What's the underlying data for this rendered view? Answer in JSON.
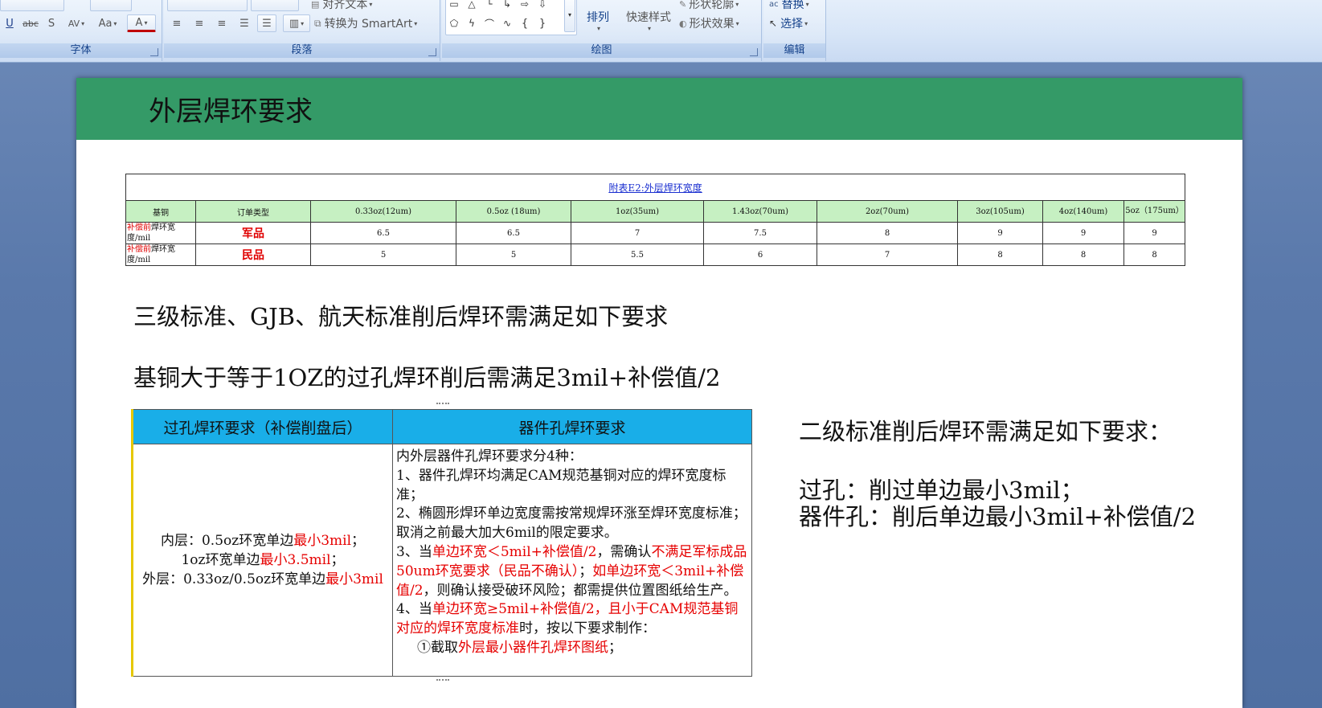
{
  "ribbon": {
    "font_group": "字体",
    "paragraph_group": "段落",
    "drawing_group": "绘图",
    "editing_group": "编辑",
    "align_text": "对齐文本",
    "convert_smartart": "转换为 SmartArt",
    "arrange": "排列",
    "quick_styles": "快速样式",
    "shape_outline": "形状轮廓",
    "shape_effects": "形状效果",
    "replace": "替换",
    "select": "选择"
  },
  "slide": {
    "title": "外层焊环要求",
    "spec_table": {
      "caption": "附表E2:外层焊环宽度",
      "headers": [
        "基铜",
        "订单类型",
        "0.33oz(12um)",
        "0.5oz (18um)",
        "1oz(35um)",
        "1.43oz(70um)",
        "2oz(70um)",
        "3oz(105um)",
        "4oz(140um)",
        "5oz（175um）"
      ],
      "rows": [
        {
          "label_red": "补偿前",
          "label_rest": "焊环宽度/mil",
          "type": "军品",
          "values": [
            "6.5",
            "6.5",
            "7",
            "7.5",
            "8",
            "9",
            "9",
            "9"
          ]
        },
        {
          "label_red": "补偿前",
          "label_rest": "焊环宽度/mil",
          "type": "民品",
          "values": [
            "5",
            "5",
            "5.5",
            "6",
            "7",
            "8",
            "8",
            "8"
          ]
        }
      ]
    },
    "line1": "三级标准、GJB、航天标准削后焊环需满足如下要求",
    "line2": "基铜大于等于1OZ的过孔焊环削后需满足3mil+补偿值/2",
    "req_table": {
      "header_left": "过孔焊环要求（补偿削盘后）",
      "header_right": "器件孔焊环要求",
      "left": {
        "l1a": "内层：0.5oz环宽单边",
        "l1b": "最小3mil",
        "l1c": "；",
        "l2a": "1oz环宽单边",
        "l2b": "最小3.5mil",
        "l2c": "；",
        "l3a": "外层：0.33oz/0.5oz环宽单边",
        "l3b": "最小3mil"
      },
      "right": {
        "r1": "内外层器件孔焊环要求分4种：",
        "r2": "1、器件孔焊环均满足CAM规范基铜对应的焊环宽度标准；",
        "r3": "2、椭圆形焊环单边宽度需按常规焊环涨至焊环宽度标准；取消之前最大加大6mil的限定要求。",
        "r4a": "3、当",
        "r4b": "单边环宽＜5mil+补偿值/2",
        "r4c": "，需确认",
        "r4d": "不满足军标成品50um环宽要求（民品不确认）",
        "r4e": "；",
        "r4f": "如单边环宽＜3mil+补偿值/2",
        "r4g": "，则确认接受破环风险；都需提供位置图纸给生产。",
        "r5a": "4、当",
        "r5b": "单边环宽≥5mil+补偿值/2，且小于CAM规范基铜对应的焊环宽度标准",
        "r5c": "时，按以下要求制作：",
        "r6a": "①截取",
        "r6b": "外层最小器件孔焊环图纸",
        "r6c": "；"
      }
    },
    "side1": "二级标准削后焊环需满足如下要求：",
    "side2": "过孔：削过单边最小3mil；",
    "side3": "器件孔：削后单边最小3mil+补偿值/2"
  }
}
